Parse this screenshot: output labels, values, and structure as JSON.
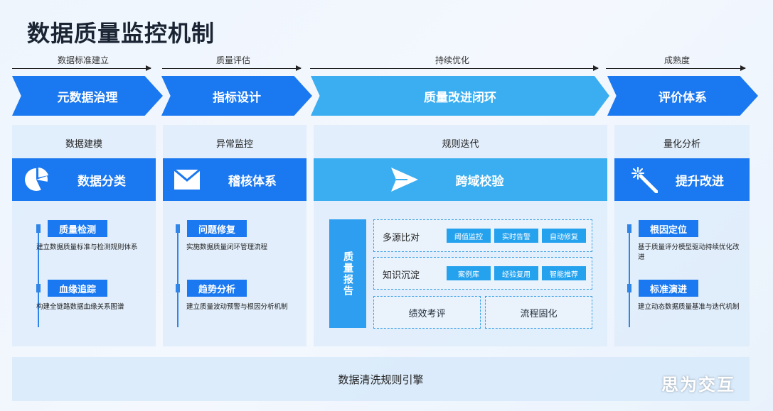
{
  "title": "数据质量监控机制",
  "stages": [
    {
      "top_label": "数据标准建立",
      "chevron": "元数据治理"
    },
    {
      "top_label": "质量评估",
      "chevron": "指标设计"
    },
    {
      "top_label": "持续优化",
      "chevron": "质量改进闭环"
    },
    {
      "top_label": "成熟度",
      "chevron": "评价体系"
    }
  ],
  "columns": [
    {
      "title": "数据建模",
      "band": "数据分类",
      "icon": "pie-chart-icon",
      "items": [
        {
          "tag": "质量检测",
          "desc": "建立数据质量标准与检测规则体系"
        },
        {
          "tag": "血缘追踪",
          "desc": "构建全链路数据血缘关系图谱"
        }
      ]
    },
    {
      "title": "异常监控",
      "band": "稽核体系",
      "icon": "envelope-icon",
      "items": [
        {
          "tag": "问题修复",
          "desc": "实施数据质量闭环管理流程"
        },
        {
          "tag": "趋势分析",
          "desc": "建立质量波动预警与根因分析机制"
        }
      ]
    },
    {
      "title": "规则迭代",
      "band": "跨域校验",
      "icon": "send-icon",
      "report": "质量报告",
      "rows": [
        {
          "label": "多源比对",
          "chips": [
            "阈值监控",
            "实时告警",
            "自动修复"
          ]
        },
        {
          "label": "知识沉淀",
          "chips": [
            "案例库",
            "经验复用",
            "智能推荐"
          ]
        }
      ],
      "bottom_boxes": [
        "绩效考评",
        "流程固化"
      ]
    },
    {
      "title": "量化分析",
      "band": "提升改进",
      "icon": "magic-wand-icon",
      "items": [
        {
          "tag": "根因定位",
          "desc": "基于质量评分模型驱动持续优化改进"
        },
        {
          "tag": "标准演进",
          "desc": "建立动态数据质量基准与迭代机制"
        }
      ]
    }
  ],
  "bottom_bar": "数据清洗规则引擎",
  "watermark": "思为交互",
  "colors": {
    "primary": "#1a78f0",
    "light": "#3aaef0",
    "chip": "#25a2ee"
  }
}
